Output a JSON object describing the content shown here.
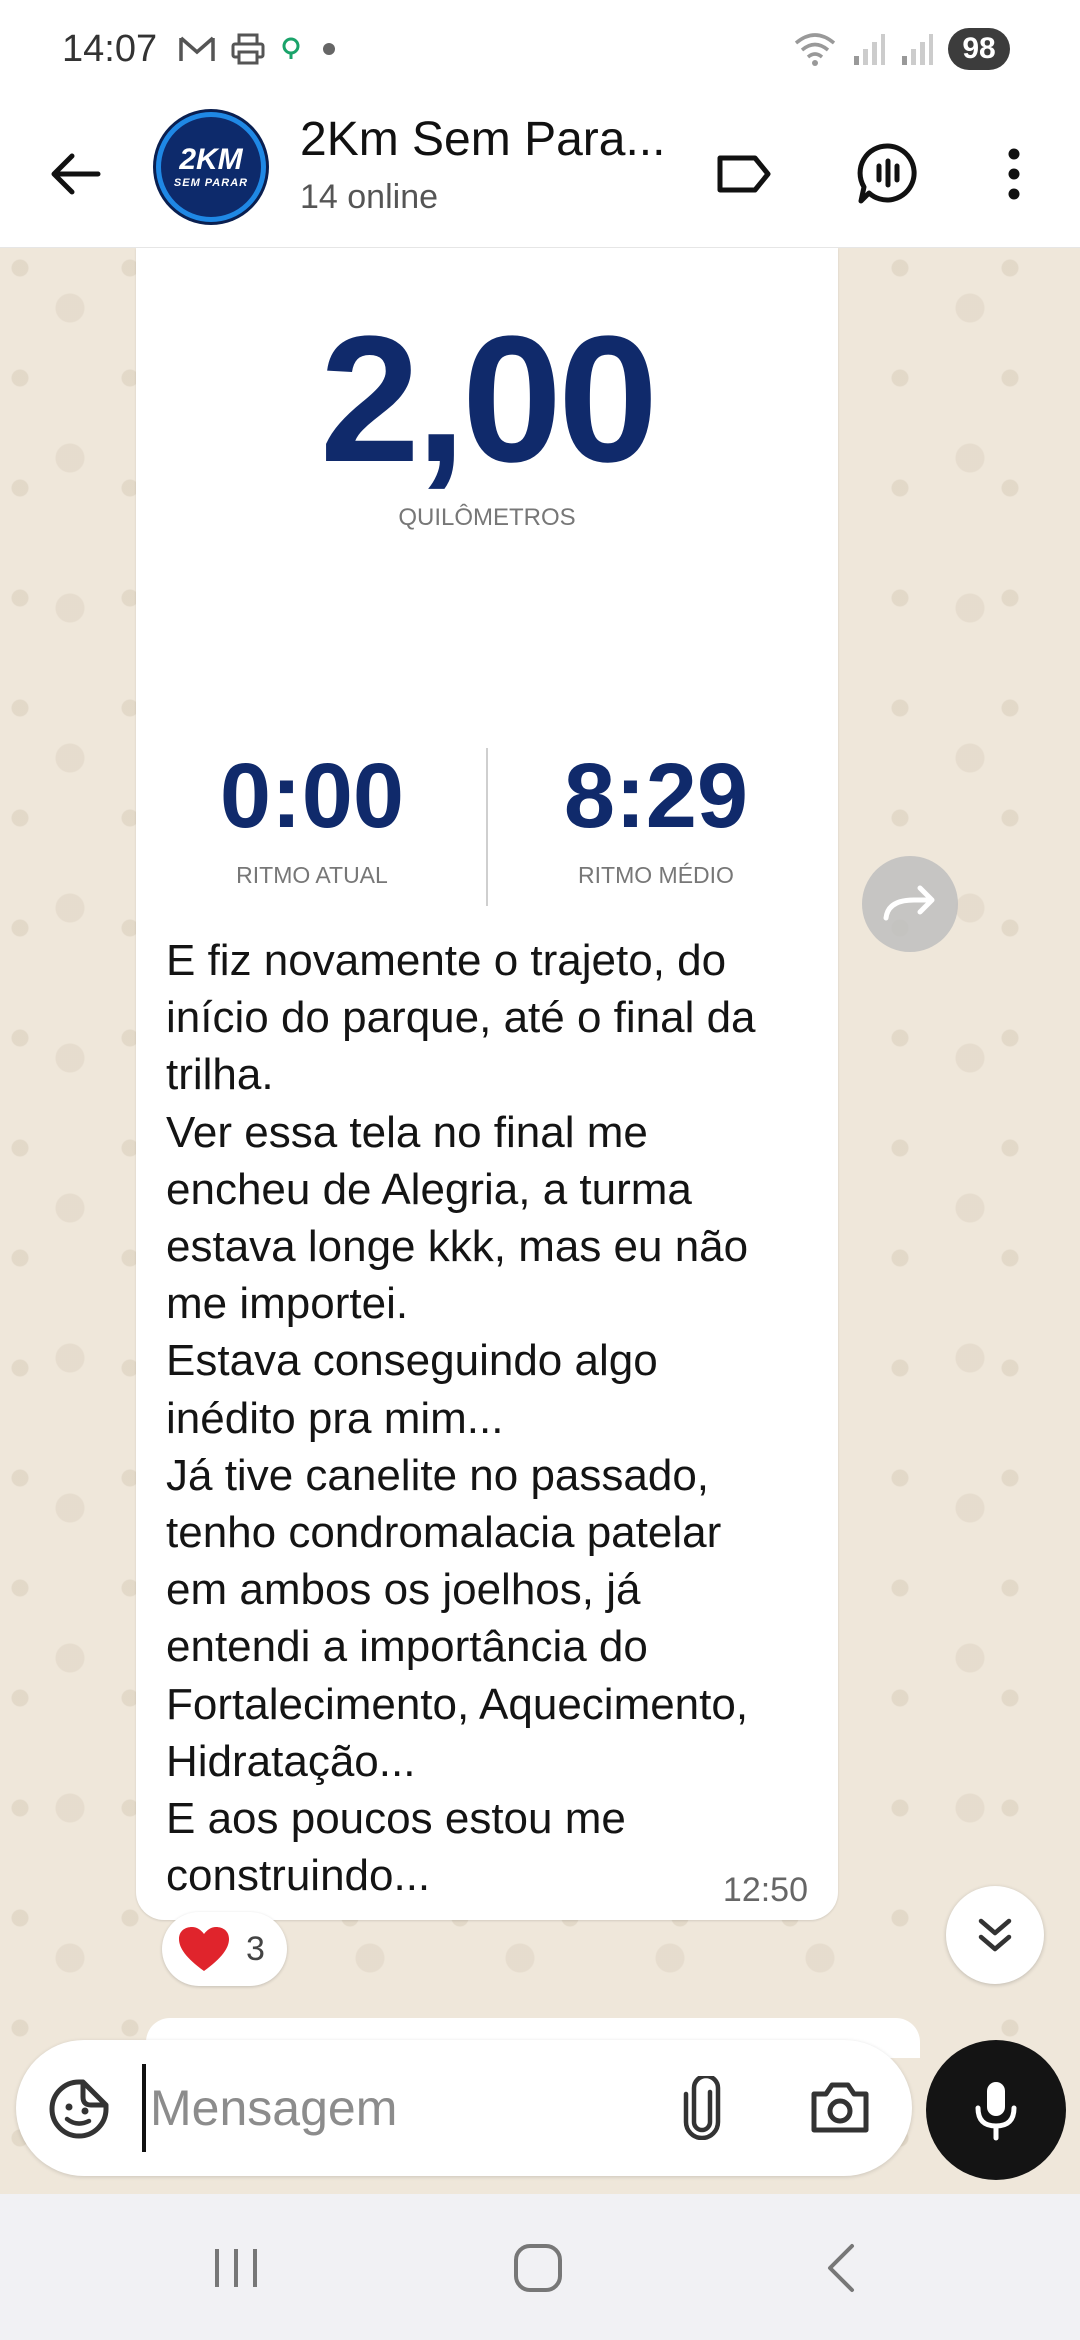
{
  "status_bar": {
    "time": "14:07",
    "left_icons": [
      "gmail-icon",
      "print-icon",
      "location-icon",
      "dot-icon"
    ],
    "right_icons": [
      "wifi-icon",
      "signal-icon",
      "signal-icon"
    ],
    "battery": "98"
  },
  "header": {
    "avatar_line1": "2KM",
    "avatar_line2": "SEM PARAR",
    "title": "2Km Sem Para...",
    "subtitle": "14 online",
    "icons": [
      "back-arrow-icon",
      "label-icon",
      "voice-chat-icon",
      "more-vert-icon"
    ]
  },
  "message": {
    "image": {
      "distance_value": "2,00",
      "distance_label": "QUILÔMETROS",
      "current_pace_value": "0:00",
      "current_pace_label": "RITMO ATUAL",
      "avg_pace_value": "8:29",
      "avg_pace_label": "RITMO MÉDIO"
    },
    "text": "E fiz novamente o trajeto, do\ninício do parque, até o final da\ntrilha.\nVer essa tela no final me\nencheu de Alegria, a turma\nestava longe kkk, mas eu não\nme importei.\nEstava conseguindo algo\ninédito pra mim...\nJá tive canelite no passado,\ntenho condromalacia patelar\nem ambos os joelhos, já\nentendi a importância do\nFortalecimento, Aquecimento,\nHidratação...\nE aos poucos estou me\nconstruindo...",
    "time": "12:50",
    "reaction_emoji": "❤️",
    "reaction_count": "3"
  },
  "composer": {
    "placeholder": "Mensagem",
    "value": ""
  },
  "colors": {
    "accent_dark": "#141414",
    "stat_blue": "#102a6b",
    "chat_background": "#efe7da",
    "heart": "#e0242c"
  }
}
